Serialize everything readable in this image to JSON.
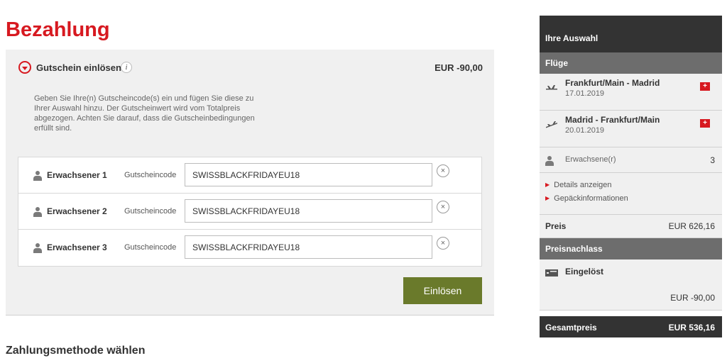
{
  "page": {
    "title": "Bezahlung",
    "payment_heading": "Zahlungsmethode wählen"
  },
  "voucher": {
    "title": "Gutschein einlösen",
    "info_icon_text": "i",
    "amount": "EUR -90,00",
    "description": "Geben Sie Ihre(n) Gutscheincode(s) ein und fügen Sie diese zu Ihrer Auswahl hinzu. Der Gutscheinwert wird vom Totalpreis abgezogen. Achten Sie darauf, dass die Gutscheinbedingungen erfüllt sind.",
    "code_label": "Gutscheincode",
    "remove_symbol": "×",
    "redeem_label": "Einlösen",
    "passengers": [
      {
        "label": "Erwachsener 1",
        "code": "SWISSBLACKFRIDAYEU18"
      },
      {
        "label": "Erwachsener 2",
        "code": "SWISSBLACKFRIDAYEU18"
      },
      {
        "label": "Erwachsener 3",
        "code": "SWISSBLACKFRIDAYEU18"
      }
    ]
  },
  "sidebar": {
    "header": "Ihre Auswahl",
    "flights_heading": "Flüge",
    "flights": [
      {
        "route": "Frankfurt/Main - Madrid",
        "date": "17.01.2019",
        "icon": "plane-departure-icon"
      },
      {
        "route": "Madrid - Frankfurt/Main",
        "date": "20.01.2019",
        "icon": "plane-arrival-icon"
      }
    ],
    "passengers_label": "Erwachsene(r)",
    "passengers_count": "3",
    "links": {
      "details": "Details anzeigen",
      "baggage": "Gepäckinformationen"
    },
    "price_label": "Preis",
    "price_value": "EUR 626,16",
    "discount_heading": "Preisnachlass",
    "redeemed_label": "Eingelöst",
    "discount_value": "EUR -90,00",
    "total_label": "Gesamtpreis",
    "total_value": "EUR 536,16"
  },
  "colors": {
    "brand_red": "#d71920",
    "redeem_button": "#6a7a2b",
    "dark_header": "#333333",
    "section_header": "#6d6d6d",
    "panel_bg": "#f0f0f0"
  }
}
